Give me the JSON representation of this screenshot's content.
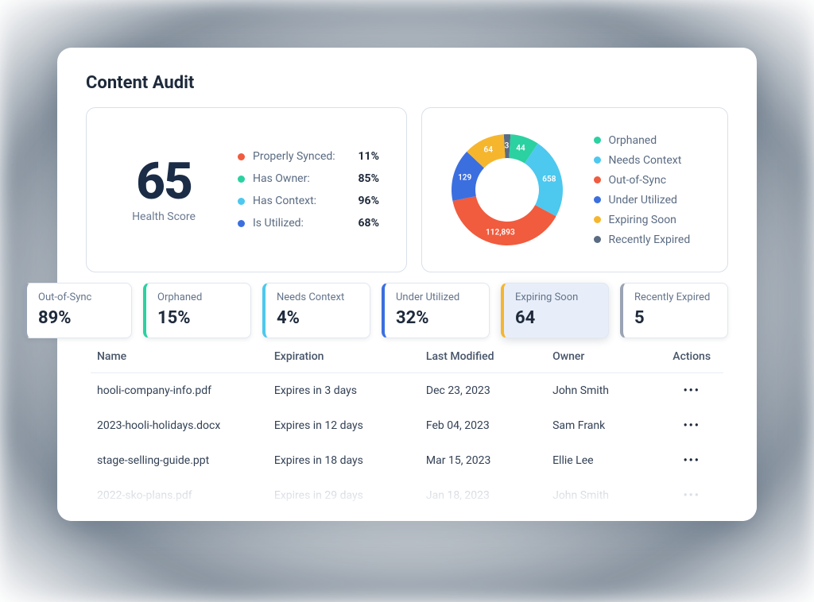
{
  "title": "Content Audit",
  "health": {
    "score": "65",
    "label": "Health Score",
    "metrics": [
      {
        "name": "Properly Synced:",
        "value": "11%",
        "color": "#f15b3e"
      },
      {
        "name": "Has Owner:",
        "value": "85%",
        "color": "#2bd1a1"
      },
      {
        "name": "Has Context:",
        "value": "96%",
        "color": "#4dc8ef"
      },
      {
        "name": "Is Utilized:",
        "value": "68%",
        "color": "#3b6fe0"
      }
    ]
  },
  "chart_data": {
    "type": "pie",
    "title": "",
    "series": [
      {
        "name": "Orphaned",
        "value": 44,
        "color": "#2bd1a1",
        "label": "44"
      },
      {
        "name": "Needs Context",
        "value": 658,
        "color": "#4dc8ef",
        "label": "658"
      },
      {
        "name": "Out-of-Sync",
        "value": 112893,
        "color": "#f15b3e",
        "label": "112,893"
      },
      {
        "name": "Under Utilized",
        "value": 129,
        "color": "#3b6fe0",
        "label": "129"
      },
      {
        "name": "Expiring Soon",
        "value": 64,
        "color": "#f5b62e",
        "label": "64"
      },
      {
        "name": "Recently Expired",
        "value": 3,
        "color": "#5a6b82",
        "label": "3"
      }
    ],
    "legend_order": [
      "Orphaned",
      "Needs Context",
      "Out-of-Sync",
      "Under Utilized",
      "Expiring Soon",
      "Recently Expired"
    ]
  },
  "tabs": [
    {
      "label": "Out-of-Sync",
      "value": "89%",
      "accent": "#9aa4b4",
      "active": false
    },
    {
      "label": "Orphaned",
      "value": "15%",
      "accent": "#2bd1a1",
      "active": false
    },
    {
      "label": "Needs Context",
      "value": "4%",
      "accent": "#4dc8ef",
      "active": false
    },
    {
      "label": "Under Utilized",
      "value": "32%",
      "accent": "#3b6fe0",
      "active": false
    },
    {
      "label": "Expiring Soon",
      "value": "64",
      "accent": "#f5b62e",
      "active": true
    },
    {
      "label": "Recently Expired",
      "value": "5",
      "accent": "#9aa4b4",
      "active": false
    }
  ],
  "table": {
    "columns": [
      "Name",
      "Expiration",
      "Last Modified",
      "Owner",
      "Actions"
    ],
    "rows": [
      {
        "name": "hooli-company-info.pdf",
        "exp": "Expires in 3 days",
        "mod": "Dec 23, 2023",
        "owner": "John Smith",
        "faded": false
      },
      {
        "name": "2023-hooli-holidays.docx",
        "exp": "Expires in 12 days",
        "mod": "Feb 04, 2023",
        "owner": "Sam Frank",
        "faded": false
      },
      {
        "name": "stage-selling-guide.ppt",
        "exp": "Expires in 18 days",
        "mod": "Mar 15, 2023",
        "owner": "Ellie Lee",
        "faded": false
      },
      {
        "name": "2022-sko-plans.pdf",
        "exp": "Expires in 29 days",
        "mod": "Jan 18, 2023",
        "owner": "John Smith",
        "faded": true
      }
    ],
    "action_glyph": "•••"
  }
}
